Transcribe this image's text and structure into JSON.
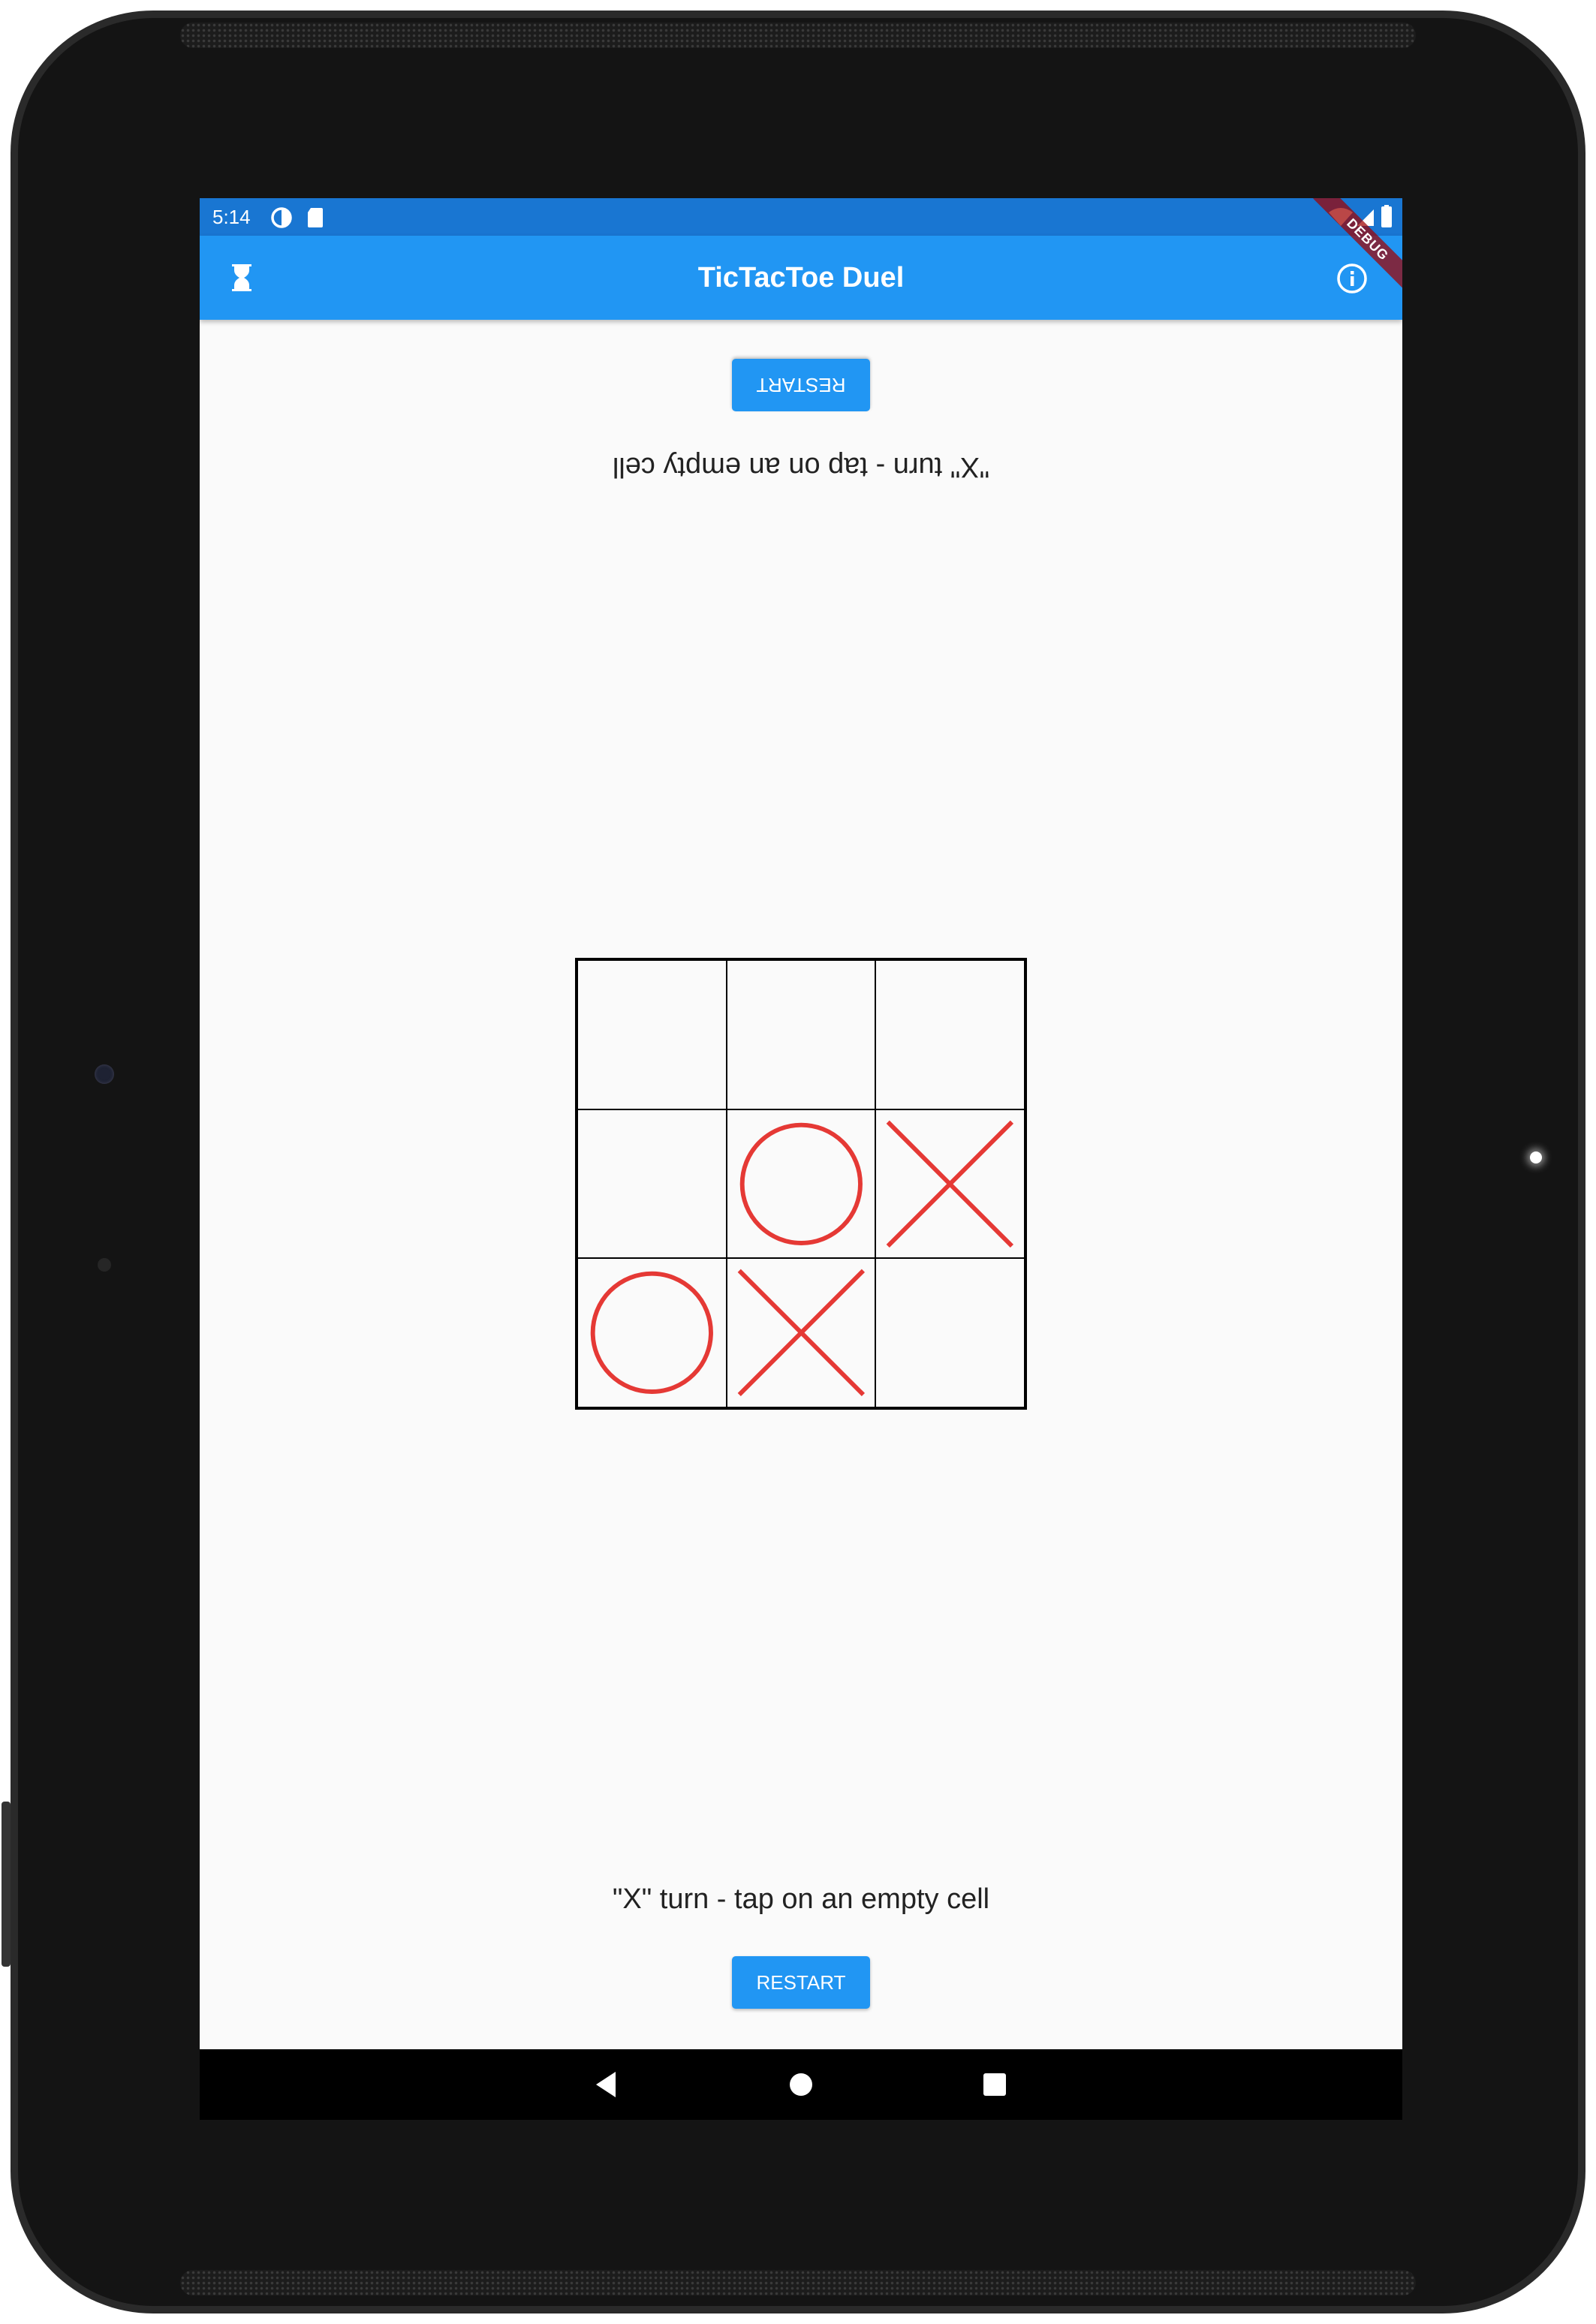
{
  "status_bar": {
    "time": "5:14"
  },
  "app_bar": {
    "title": "TicTacToe Duel",
    "left_icon": "hourglass-icon",
    "right_icon": "info-icon",
    "debug_banner": "DEBUG"
  },
  "top_player": {
    "restart_label": "RESTART",
    "message": "\"X\" turn - tap on an empty cell"
  },
  "bottom_player": {
    "message": "\"X\" turn - tap on an empty cell",
    "restart_label": "RESTART"
  },
  "board": {
    "cells": [
      "",
      "",
      "",
      "",
      "O",
      "X",
      "O",
      "X",
      ""
    ]
  },
  "colors": {
    "status_bar": "#1976d2",
    "app_bar": "#2196f3",
    "mark": "#e53935",
    "background": "#fafafa"
  },
  "nav_bar": {
    "buttons": [
      "back-icon",
      "home-icon",
      "recents-icon"
    ]
  }
}
